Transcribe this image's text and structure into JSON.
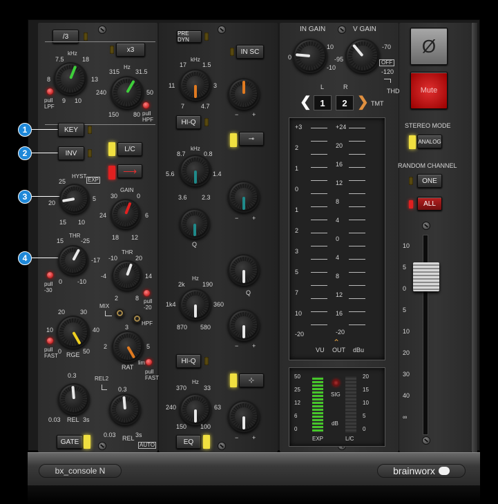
{
  "module1": {
    "div3": "/3",
    "x3": "x3",
    "lpf_khz": "kHz",
    "lpf_7_5": "7.5",
    "lpf_18": "18",
    "lpf_8": "8",
    "lpf_13": "13",
    "lpf_9": "9",
    "lpf_10": "10",
    "pull_lpf": "pull\nLPF",
    "hpf_hz": "Hz",
    "hpf_315": "315",
    "hpf_31_5": "31.5",
    "hpf_240": "240",
    "hpf_50": "50",
    "hpf_150": "150",
    "hpf_80": "80",
    "pull_hpf": "pull\nHPF",
    "key": "KEY",
    "inv": "INV",
    "lc": "L/C",
    "hyst": "HYST",
    "exp": "EXP",
    "hyst_25": "25",
    "hyst_5": "5",
    "hyst_20": "20",
    "hyst_15": "15",
    "hyst_10": "10",
    "gain": "GAIN",
    "gain_30": "30",
    "gain_0": "0",
    "gain_24": "24",
    "gain_6": "6",
    "gain_18": "18",
    "gain_12": "12",
    "thr": "THR",
    "thr_15": "15",
    "thr_m25": "-25",
    "thr_m17": "-17",
    "thr_0": "0",
    "thr_m10": "-10",
    "pull_m30": "pull\n-30",
    "thr2": "THR",
    "thr2_m10": "-10",
    "thr2_20": "20",
    "thr2_m4": "-4",
    "thr2_14": "14",
    "thr2_2": "2",
    "thr2_8": "8",
    "pull_m20": "pull\n-20",
    "mix": "MIX",
    "hpf": "HPF",
    "rge_20": "20",
    "rge_30": "30",
    "rge_10": "10",
    "rge_40": "40",
    "rge_0": "0",
    "rge": "RGE",
    "rge_50": "50",
    "pull_fast": "pull\nFAST",
    "rat_3": "3",
    "rat_2": "2",
    "rat_5": "5",
    "rat": "RAT",
    "rat_lim": "lim",
    "pull_fast2": "pull\nFAST",
    "rel_0_3": "0.3",
    "rel": "REL",
    "rel_003": "0.03",
    "rel_3s": "3s",
    "rel2": "REL2",
    "rel2_0_3": "0.3",
    "rel2_003": "0.03",
    "rel2_rel": "REL",
    "rel2_3s": "3s",
    "auto": "AUTO",
    "gate": "GATE"
  },
  "module2": {
    "pre_dyn": "PRE DYN",
    "in_sc": "IN SC",
    "hf_17": "17",
    "hf_khz": "kHz",
    "hf_1_5": "1.5",
    "hf_11": "11",
    "hf_3": "3",
    "hf_7": "7",
    "hf_4_7": "4.7",
    "hiq1": "HI-Q",
    "hiq2": "HI-Q",
    "hmf_8_7": "8.7",
    "hmf_khz": "kHz",
    "hmf_0_8": "0.8",
    "hmf_5_6": "5.6",
    "hmf_1_4": "1.4",
    "hmf_3_6": "3.6",
    "hmf_2_3": "2.3",
    "q1": "Q",
    "q2": "Q",
    "lmf_2k": "2k",
    "lmf_hz": "Hz",
    "lmf_190": "190",
    "lmf_1k4": "1k4",
    "lmf_360": "360",
    "lmf_870": "870",
    "lmf_580": "580",
    "lf_370": "370",
    "lf_hz": "Hz",
    "lf_33": "33",
    "lf_240": "240",
    "lf_63": "63",
    "lf_150": "150",
    "lf_100": "100",
    "eq": "EQ",
    "minus": "−",
    "plus": "+"
  },
  "module3": {
    "in_gain": "IN GAIN",
    "in_0": "0",
    "in_10": "10",
    "in_m10": "-10",
    "v_gain": "V GAIN",
    "v_m70": "-70",
    "v_m95": "-95",
    "v_m120": "-120",
    "off": "OFF",
    "l": "L",
    "r": "R",
    "ch1": "1",
    "ch2": "2",
    "tmt": "TMT",
    "thd": "THD",
    "vu_left": [
      "+3",
      "2",
      "1",
      "0",
      "1",
      "2",
      "3",
      "5",
      "7",
      "10",
      "-20"
    ],
    "vu_right": [
      "+24",
      "20",
      "16",
      "12",
      "8",
      "4",
      "0",
      "4",
      "8",
      "12",
      "16",
      "-20"
    ],
    "vu": "VU",
    "out": "OUT",
    "dbu": "dBu",
    "gr_left": [
      "50",
      "25",
      "12",
      "6",
      "0"
    ],
    "gr_right": [
      "20",
      "15",
      "10",
      "5",
      "0"
    ],
    "sig": "SIG",
    "db": "dB",
    "exp": "EXP",
    "lc": "L/C"
  },
  "module4": {
    "phase": "Ø",
    "mute": "Mute",
    "stereo_mode": "STEREO MODE",
    "analog": "ANALOG",
    "random_channel": "RANDOM CHANNEL",
    "one": "ONE",
    "all": "ALL",
    "fader_scale": [
      "10",
      "5",
      "0",
      "5",
      "10",
      "20",
      "30",
      "40",
      "∞"
    ]
  },
  "footer": {
    "product": "bx_console N",
    "brand": "brainworx"
  },
  "callouts": [
    "1",
    "2",
    "3",
    "4"
  ],
  "colors": {
    "accent_green": "#3ecf3a",
    "accent_red": "#e22020",
    "accent_yellow": "#f0d020",
    "accent_orange": "#e07a20",
    "accent_teal": "#1f8a8a",
    "callout_blue": "#1f88d8"
  }
}
